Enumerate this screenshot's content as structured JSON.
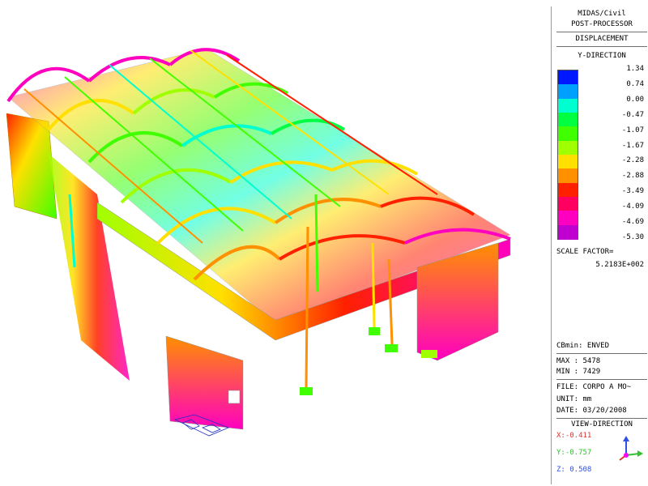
{
  "panel": {
    "app": "MIDAS/Civil",
    "processor": "POST-PROCESSOR",
    "result_type": "DISPLACEMENT",
    "direction": "Y-DIRECTION",
    "legend": {
      "values": [
        "1.34",
        "0.74",
        "0.00",
        "-0.47",
        "-1.07",
        "-1.67",
        "-2.28",
        "-2.88",
        "-3.49",
        "-4.09",
        "-4.69",
        "-5.30"
      ],
      "colors": [
        "#0018ff",
        "#00a0ff",
        "#00ffd0",
        "#00ff40",
        "#40ff00",
        "#a0ff00",
        "#ffe000",
        "#ff9000",
        "#ff2000",
        "#ff0060",
        "#ff00c0",
        "#c000d0"
      ]
    },
    "scale_factor_label": "SCALE FACTOR=",
    "scale_factor_value": "5.2183E+002",
    "cb": "CBmin: ENVED",
    "max": "MAX : 5478",
    "min": "MIN : 7429",
    "file": "FILE: CORPO A MO~",
    "unit": "UNIT: mm",
    "date": "DATE: 03/20/2008",
    "view_title": "VIEW-DIRECTION",
    "view_x": "X:-0.411",
    "view_y": "Y:-0.757",
    "view_z": "Z: 0.508",
    "view_colors": {
      "x": "#e03030",
      "y": "#30c030",
      "z": "#3050e0"
    }
  }
}
